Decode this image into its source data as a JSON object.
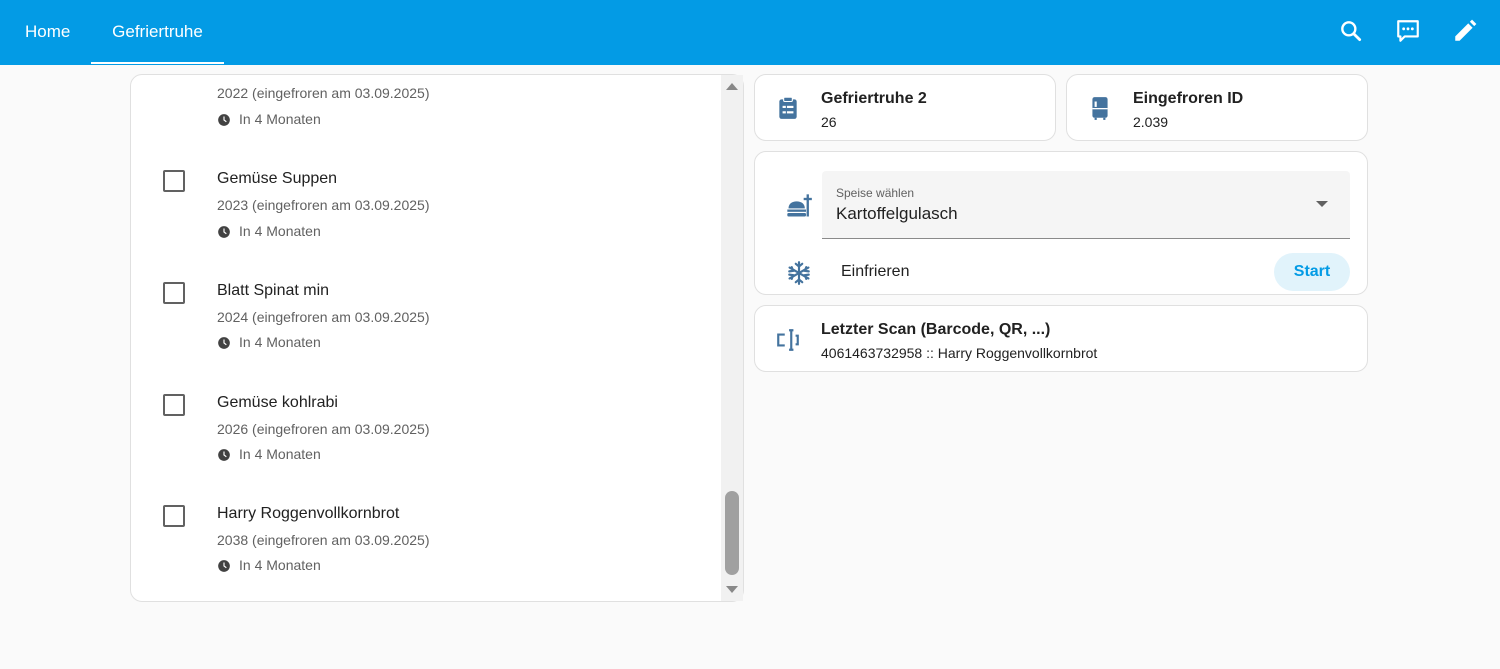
{
  "topbar": {
    "tabs": [
      {
        "label": "Home"
      },
      {
        "label": "Gefriertruhe"
      }
    ],
    "icons": [
      "search-icon",
      "assist-icon",
      "edit-icon"
    ]
  },
  "todo_list": {
    "items": [
      {
        "title": "",
        "sub": "2022 (eingefroren am 03.09.2025)",
        "due": "In 4 Monaten"
      },
      {
        "title": "Gemüse Suppen",
        "sub": "2023 (eingefroren am 03.09.2025)",
        "due": "In 4 Monaten"
      },
      {
        "title": "Blatt Spinat min",
        "sub": "2024 (eingefroren am 03.09.2025)",
        "due": "In 4 Monaten"
      },
      {
        "title": "Gemüse kohlrabi",
        "sub": "2026 (eingefroren am 03.09.2025)",
        "due": "In 4 Monaten"
      },
      {
        "title": "Harry Roggenvollkornbrot",
        "sub": "2038 (eingefroren am 03.09.2025)",
        "due": "In 4 Monaten"
      }
    ]
  },
  "entities": {
    "gefriertruhe": {
      "name": "Gefriertruhe 2",
      "state": "26",
      "icon": "clipboard-list-icon"
    },
    "eingefroren": {
      "name": "Eingefroren ID",
      "state": "2.039",
      "icon": "fridge-icon"
    }
  },
  "form": {
    "select_label": "Speise wählen",
    "select_value": "Kartoffelgulasch",
    "action_label": "Einfrieren",
    "start_label": "Start"
  },
  "scan": {
    "name": "Letzter Scan (Barcode, QR, ...)",
    "state": "4061463732958 :: Harry Roggenvollkornbrot",
    "icon": "scan-icon"
  },
  "colors": {
    "header": "#039be5",
    "icon": "#44739e",
    "accent": "#039be5"
  }
}
